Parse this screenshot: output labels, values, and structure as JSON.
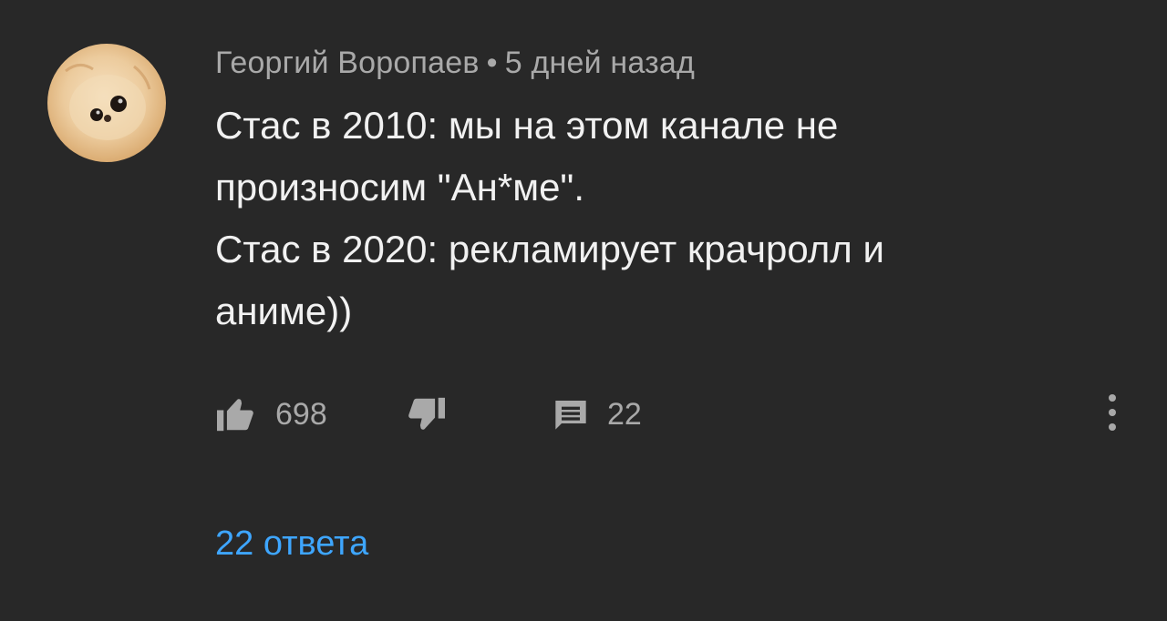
{
  "comment": {
    "author": "Георгий Воропаев",
    "separator": "•",
    "time": "5 дней назад",
    "lines": [
      "Стас в 2010: мы на этом канале не",
      "произносим \"Ан*ме\".",
      "Стас в 2020: рекламирует крачролл и",
      "аниме))"
    ],
    "likes": "698",
    "replies_count": "22",
    "replies_link": "22 ответа"
  },
  "icons": {
    "avatar": "avatar-image",
    "like": "thumb-up-icon",
    "dislike": "thumb-down-icon",
    "reply": "reply-icon",
    "more": "more-vertical-icon"
  },
  "colors": {
    "background": "#282828",
    "text": "#f1f1f1",
    "secondary": "#a9a9a9",
    "link": "#3ea6ff"
  }
}
